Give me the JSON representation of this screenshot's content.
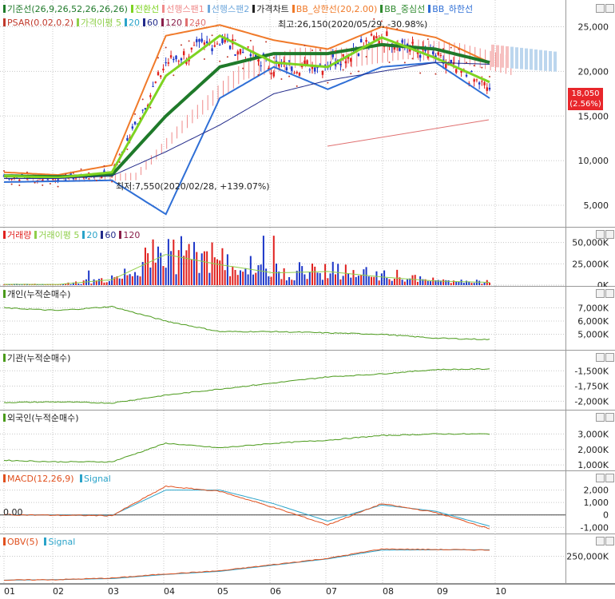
{
  "colors": {
    "up": "#e0201e",
    "down": "#1c36c8",
    "base": "#1f7a2a",
    "conv": "#7ed321",
    "lead1": "#f08a8a",
    "lead2": "#6fa8dc",
    "bbUpper": "#f07a2a",
    "bbMid": "#2f8a2f",
    "bbLower": "#2f6fd6",
    "psar": "#c0392b",
    "ma5": "#8fcf4a",
    "ma20": "#2aa3c9",
    "ma60": "#222a8a",
    "ma120": "#8a1f4a",
    "ma240": "#e07070",
    "grid": "#c8c8c8",
    "green": "#4a9a1a",
    "signal": "#2aa3c9",
    "macd": "#e0501e"
  },
  "price_panel": {
    "legend": [
      {
        "label": "기준선(26,9,26,52,26,26,26)",
        "color": "#1f7a2a"
      },
      {
        "label": "전환선",
        "color": "#7ed321"
      },
      {
        "label": "선행스팬1",
        "color": "#f08a8a"
      },
      {
        "label": "선행스팬2",
        "color": "#6fa8dc"
      },
      {
        "label": "가격차트",
        "color": "#222222"
      },
      {
        "label": "BB_상한선(20,2.00)",
        "color": "#f07a2a"
      },
      {
        "label": "BB_중심선",
        "color": "#2f8a2f"
      },
      {
        "label": "BB_하한선",
        "color": "#2f6fd6"
      }
    ],
    "legend2": [
      {
        "label": "PSAR(0.02,0.2)",
        "color": "#c0392b"
      },
      {
        "label": "가격이평 5",
        "color": "#8fcf4a"
      },
      {
        "label": "20",
        "color": "#2aa3c9"
      },
      {
        "label": "60",
        "color": "#222a8a"
      },
      {
        "label": "120",
        "color": "#8a1f4a"
      },
      {
        "label": "240",
        "color": "#e07070"
      }
    ],
    "high_note": "최고:26,150(2020/05/29, -30.98%)",
    "low_note": "최저:7,550(2020/02/28, +139.07%)",
    "last_price": "18,050",
    "last_change": "(2.56%)"
  },
  "volume_panel": {
    "legend": [
      {
        "label": "거래량",
        "color": "#e0201e"
      },
      {
        "label": "거래이평 5",
        "color": "#8fcf4a"
      },
      {
        "label": "20",
        "color": "#2aa3c9"
      },
      {
        "label": "60",
        "color": "#222a8a"
      },
      {
        "label": "120",
        "color": "#8a1f4a"
      }
    ]
  },
  "indiv_panel": {
    "title": "개인(누적순매수)"
  },
  "inst_panel": {
    "title": "기관(누적순매수)"
  },
  "foreign_panel": {
    "title": "외국인(누적순매수)"
  },
  "macd_panel": {
    "title": "MACD(12,26,9)",
    "signal": "Signal",
    "zero_label": "0.00"
  },
  "obv_panel": {
    "title": "OBV(5)",
    "signal": "Signal"
  },
  "chart_data": [
    {
      "type": "line",
      "title": "",
      "x": [
        "01",
        "02",
        "03",
        "04",
        "05",
        "06",
        "07",
        "08",
        "09",
        "10"
      ],
      "ylim": [
        2500,
        28000
      ],
      "yticks": [
        "25,000",
        "20,000",
        "15,000",
        "10,000",
        "5,000"
      ],
      "series": [
        {
          "name": "가격차트",
          "values": [
            8200,
            8000,
            8600,
            21000,
            23500,
            20500,
            20800,
            24000,
            21500,
            18050
          ]
        },
        {
          "name": "기준선",
          "values": [
            8300,
            8200,
            8400,
            15000,
            20500,
            22000,
            22000,
            23000,
            22500,
            21000
          ]
        },
        {
          "name": "전환선",
          "values": [
            8300,
            8100,
            8700,
            19500,
            24000,
            21000,
            20500,
            23800,
            21500,
            18800
          ]
        },
        {
          "name": "BB_상한선",
          "values": [
            8700,
            8400,
            9500,
            24000,
            25200,
            23500,
            22500,
            25000,
            23800,
            21000
          ]
        },
        {
          "name": "BB_하한선",
          "values": [
            7600,
            7700,
            7800,
            4000,
            17000,
            20500,
            18000,
            20500,
            21000,
            17000
          ]
        }
      ]
    },
    {
      "type": "bar",
      "title": "",
      "ylim": [
        0,
        60000
      ],
      "yticks": [
        "50,000K",
        "25,000K",
        "0K"
      ],
      "x": [
        "01",
        "02",
        "03",
        "04",
        "05",
        "06",
        "07",
        "08",
        "09",
        "10"
      ],
      "values": [
        1200,
        1000,
        8000,
        45000,
        30000,
        18000,
        20000,
        12000,
        6000,
        4000
      ]
    },
    {
      "type": "line",
      "title": "개인(누적순매수)",
      "ylim": [
        4000,
        8000
      ],
      "yticks": [
        "7,000K",
        "6,000K",
        "5,000K"
      ],
      "x": [
        "01",
        "02",
        "03",
        "04",
        "05",
        "06",
        "07",
        "08",
        "09",
        "10"
      ],
      "values": [
        7000,
        6800,
        7100,
        6000,
        5200,
        5200,
        5100,
        5000,
        4700,
        4600
      ]
    },
    {
      "type": "line",
      "title": "기관(누적순매수)",
      "ylim": [
        -2100,
        -1300
      ],
      "yticks": [
        "-1,500K",
        "-1,750K",
        "-2,000K"
      ],
      "x": [
        "01",
        "02",
        "03",
        "04",
        "05",
        "06",
        "07",
        "08",
        "09",
        "10"
      ],
      "values": [
        -2020,
        -2010,
        -2030,
        -1900,
        -1800,
        -1700,
        -1600,
        -1550,
        -1480,
        -1470
      ]
    },
    {
      "type": "line",
      "title": "외국인(누적순매수)",
      "ylim": [
        800,
        4000
      ],
      "yticks": [
        "3,000K",
        "2,000K",
        "1,000K"
      ],
      "x": [
        "01",
        "02",
        "03",
        "04",
        "05",
        "06",
        "07",
        "08",
        "09",
        "10"
      ],
      "values": [
        1300,
        1200,
        1200,
        2400,
        2100,
        2400,
        2600,
        2900,
        3000,
        3000
      ]
    },
    {
      "type": "line",
      "title": "MACD(12,26,9)",
      "ylim": [
        -1300,
        3000
      ],
      "yticks": [
        "2,000",
        "1,000",
        "0",
        "-1,000"
      ],
      "x": [
        "01",
        "02",
        "03",
        "04",
        "05",
        "06",
        "07",
        "08",
        "09",
        "10"
      ],
      "series": [
        {
          "name": "MACD",
          "values": [
            20,
            -30,
            -60,
            2300,
            1900,
            600,
            -800,
            900,
            200,
            -1100
          ]
        },
        {
          "name": "Signal",
          "values": [
            20,
            -20,
            -40,
            2000,
            2000,
            900,
            -500,
            800,
            300,
            -900
          ]
        }
      ]
    },
    {
      "type": "line",
      "title": "OBV(5)",
      "ylim": [
        0,
        400000
      ],
      "yticks": [
        "250,000K"
      ],
      "x": [
        "01",
        "02",
        "03",
        "04",
        "05",
        "06",
        "07",
        "08",
        "09",
        "10"
      ],
      "series": [
        {
          "name": "OBV",
          "values": [
            20000,
            25000,
            40000,
            80000,
            110000,
            170000,
            230000,
            320000,
            315000,
            310000
          ]
        },
        {
          "name": "Signal",
          "values": [
            20000,
            25000,
            35000,
            75000,
            105000,
            165000,
            225000,
            310000,
            312000,
            312000
          ]
        }
      ]
    }
  ]
}
